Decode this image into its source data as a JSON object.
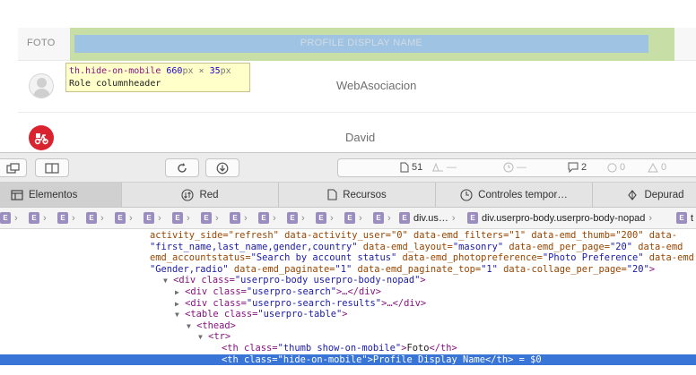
{
  "table": {
    "header": {
      "foto": "FOTO",
      "name": "PROFILE DISPLAY NAME"
    },
    "rows": [
      {
        "name": "WebAsociacion"
      },
      {
        "name": "David"
      }
    ]
  },
  "tooltip": {
    "selector": "th.hide-on-mobile",
    "width": "660",
    "height": "35",
    "unit": "px",
    "times": "×",
    "role_label": "Role",
    "role_value": "columnheader"
  },
  "toolbar": {
    "resources_count": "51",
    "messages_count": "2",
    "errors_count": "0",
    "warnings_count": "0"
  },
  "tabs": [
    {
      "label": "Elementos"
    },
    {
      "label": "Red"
    },
    {
      "label": "Recursos"
    },
    {
      "label": "Controles tempor…"
    },
    {
      "label": "Depurad"
    }
  ],
  "breadcrumbs": {
    "e_badge": "E",
    "item1": "div.us…",
    "item2": "div.userpro-body.userpro-body-nopad",
    "item3": "t"
  },
  "code": {
    "l1": "activity_side=\"refresh\" data-activity_user=\"0\" data-emd_filters=\"1\" data-emd_thumb=\"200\" data-",
    "l2a": "\"first_name,last_name,gender,country\"",
    "l2b": " data-emd_layout=",
    "l2c": "\"masonry\"",
    "l2d": " data-emd_per_page=",
    "l2e": "\"20\"",
    "l2f": " data-emd",
    "l3a": "emd_accountstatus=",
    "l3b": "\"Search by account status\"",
    "l3c": " data-emd_photopreference=",
    "l3d": "\"Photo Preference\"",
    "l3e": " data-emd",
    "l4a": "\"Gender,radio\"",
    "l4b": " data-emd_paginate=",
    "l4c": "\"1\"",
    "l4d": " data-emd_paginate_top=",
    "l4e": "\"1\"",
    "l4f": " data-collage_per_page=",
    "l4g": "\"20\"",
    "l4h": ">",
    "l5a": "<div class=",
    "l5b": "\"userpro-body userpro-body-nopad\"",
    "l5c": ">",
    "l6a": "<div class=",
    "l6b": "\"userpro-search\"",
    "l6c": ">…</div>",
    "l7a": "<div class=",
    "l7b": "\"userpro-search-results\"",
    "l7c": ">…</div>",
    "l8a": "<table class=",
    "l8b": "\"userpro-table\"",
    "l8c": ">",
    "l9": "<thead>",
    "l10": "<tr>",
    "l11a": "<th class=",
    "l11b": "\"thumb show-on-mobile\"",
    "l11c": ">",
    "l11d": "Foto",
    "l11e": "</th>",
    "l12a": "<th class=",
    "l12b": "\"hide-on-mobile\"",
    "l12c": ">",
    "l12d": "Profile Display Name",
    "l12e": "</th>",
    "l12f": " = $0"
  },
  "colors": {
    "margin_highlight": "#c7dfa6",
    "content_highlight": "#9fc3e2",
    "selected_line": "#3875d7",
    "avatar_red": "#d9232e"
  }
}
